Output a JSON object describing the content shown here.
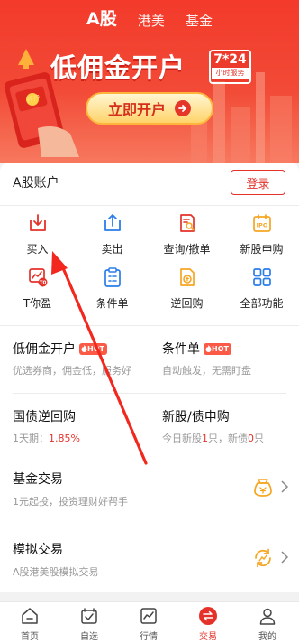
{
  "header": {
    "tabs": [
      {
        "label": "A股",
        "active": true
      },
      {
        "label": "港美",
        "active": false
      },
      {
        "label": "基金",
        "active": false
      }
    ]
  },
  "banner": {
    "title": "低佣金开户",
    "badge_main": "7*24",
    "badge_sub": "小时服务",
    "cta": "立即开户",
    "envelope_text": "开户"
  },
  "account": {
    "title": "A股账户",
    "login": "登录",
    "actions": [
      {
        "label": "买入",
        "icon": "buy-icon"
      },
      {
        "label": "卖出",
        "icon": "sell-icon"
      },
      {
        "label": "查询/撤单",
        "icon": "query-cancel-icon"
      },
      {
        "label": "新股申购",
        "icon": "ipo-icon"
      },
      {
        "label": "T你盈",
        "icon": "t-profit-icon"
      },
      {
        "label": "条件单",
        "icon": "condition-order-icon"
      },
      {
        "label": "逆回购",
        "icon": "reverse-repo-icon"
      },
      {
        "label": "全部功能",
        "icon": "all-functions-icon"
      }
    ]
  },
  "features": [
    {
      "title": "低佣金开户",
      "hot": "HOT",
      "sub": "优选券商，佣金低，服务好"
    },
    {
      "title": "条件单",
      "hot": "HOT",
      "sub": "自动触发，无需盯盘"
    },
    {
      "title": "国债逆回购",
      "sub_prefix": "1天期：",
      "sub_value": "1.85%"
    },
    {
      "title": "新股/债申购",
      "sub_prefix": "今日新股",
      "stock_count": "1",
      "sub_mid": "只，新债",
      "bond_count": "0",
      "sub_suffix": "只"
    }
  ],
  "rows": [
    {
      "title": "基金交易",
      "sub": "1元起投，投资理财好帮手",
      "icon": "fund-bag-icon"
    },
    {
      "title": "模拟交易",
      "sub": "A股港美股模拟交易",
      "icon": "simulation-icon"
    }
  ],
  "tabbar": [
    {
      "label": "首页",
      "icon": "home-icon",
      "active": false
    },
    {
      "label": "自选",
      "icon": "watchlist-icon",
      "active": false
    },
    {
      "label": "行情",
      "icon": "market-icon",
      "active": false
    },
    {
      "label": "交易",
      "icon": "trade-icon",
      "active": true
    },
    {
      "label": "我的",
      "icon": "profile-icon",
      "active": false
    }
  ],
  "colors": {
    "brand_red": "#e4322a",
    "hot_badge": "#fa5a46",
    "icon_blue": "#2b7de9",
    "icon_orange": "#f5a623",
    "annotation_arrow": "#f2281e"
  }
}
